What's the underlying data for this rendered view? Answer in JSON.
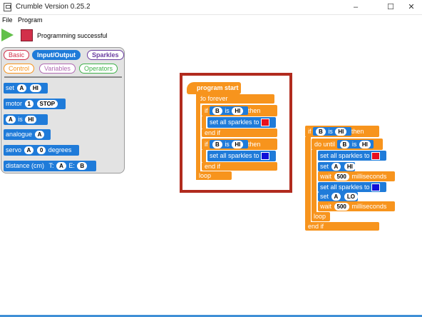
{
  "window": {
    "title": "Crumble Version 0.25.2",
    "minimize": "–",
    "maximize": "☐",
    "close": "✕",
    "icon": "app-window-icon"
  },
  "menu": {
    "file": "File",
    "program": "Program"
  },
  "toolbar": {
    "play_icon": "play-icon",
    "stop_icon": "stop-icon",
    "status": "Programming successful"
  },
  "palette": {
    "tabs": [
      {
        "label": "Basic",
        "color": "#d2304a"
      },
      {
        "label": "Input/Output",
        "color": "#1f7bd9"
      },
      {
        "label": "Sparkles",
        "color": "#6b3fa0"
      },
      {
        "label": "Control",
        "color": "#f7941d"
      },
      {
        "label": "Variables",
        "color": "#b06ab3"
      },
      {
        "label": "Operators",
        "color": "#3fb24a"
      }
    ],
    "selected_tab": "Input/Output",
    "blocks": {
      "set": {
        "label": "set",
        "pin": "A",
        "value": "HI"
      },
      "motor": {
        "label": "motor",
        "num": "1",
        "state": "STOP"
      },
      "is": {
        "pin": "A",
        "label": "is",
        "value": "HI"
      },
      "analogue": {
        "label": "analogue",
        "pin": "A"
      },
      "servo": {
        "label": "servo",
        "pin": "A",
        "value": "0",
        "unit": "degrees"
      },
      "distance": {
        "label": "distance (cm)",
        "t_label": "T:",
        "t_pin": "A",
        "e_label": "E:",
        "e_pin": "B"
      }
    }
  },
  "script1": {
    "start": "program start",
    "do_forever": "do forever",
    "if1": {
      "if": "if",
      "pin": "B",
      "is": "is",
      "value": "HI",
      "then": "then",
      "action": "set all sparkles to",
      "color": "#e8101e",
      "end": "end if"
    },
    "if2": {
      "if": "if",
      "pin": "B",
      "is": "is",
      "value": "HI",
      "then": "then",
      "action": "set all sparkles to",
      "color": "#1010d8",
      "end": "end if"
    },
    "loop": "loop"
  },
  "script2": {
    "if": "if",
    "pin": "B",
    "is": "is",
    "value": "HI",
    "then": "then",
    "do_until": "do until",
    "du_pin": "B",
    "du_is": "is",
    "du_value": "HI",
    "sparkle1": {
      "label": "set all sparkles to",
      "color": "#e8101e"
    },
    "set1": {
      "label": "set",
      "pin": "A",
      "value": "HI"
    },
    "wait1": {
      "label": "wait",
      "value": "500",
      "unit": "milliseconds"
    },
    "sparkle2": {
      "label": "set all sparkles to",
      "color": "#1010d8"
    },
    "set2": {
      "label": "set",
      "pin": "A",
      "value": "LO"
    },
    "wait2": {
      "label": "wait",
      "value": "500",
      "unit": "milliseconds"
    },
    "loop": "loop",
    "end": "end if"
  }
}
